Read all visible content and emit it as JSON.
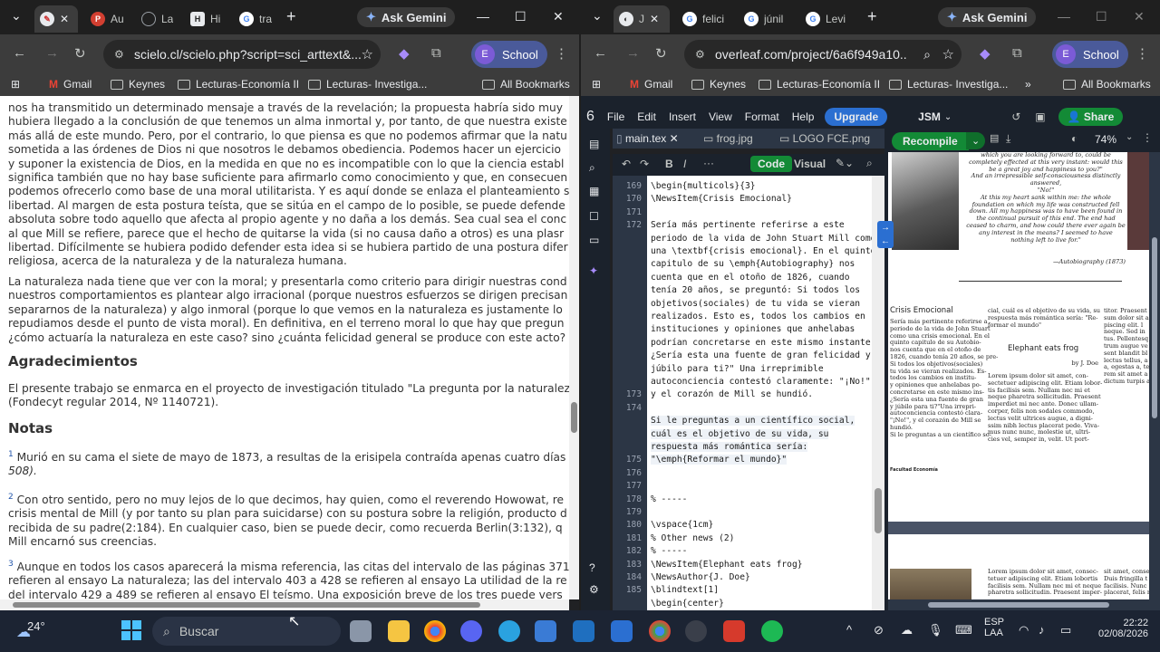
{
  "left": {
    "tabs": [
      {
        "title": "",
        "color": "#e8eaed"
      },
      {
        "title": "Au",
        "color": "#d23f31"
      },
      {
        "title": "La",
        "color": "#9aa0a6"
      },
      {
        "title": "Hi",
        "color": "#e8eaed"
      },
      {
        "title": "tra",
        "color": "#4285f4"
      }
    ],
    "gemini": "Ask Gemini",
    "url": "scielo.cl/scielo.php?script=sci_arttext&...",
    "profile": "School",
    "profile_initial": "E",
    "bookmarks": [
      "Gmail",
      "Keynes",
      "Lecturas-Economía II",
      "Lecturas- Investiga...",
      "All Bookmarks"
    ],
    "paragraphs": [
      [
        "nos ha transmitido un determinado mensaje a través de la revelación; la propuesta habría sido muy",
        "hubiera llegado a la conclusión de que tenemos un alma inmortal y, por tanto, de que nuestra existe",
        "más allá de este mundo. Pero, por el contrario, lo que piensa es que no podemos afirmar que la natu",
        "sometida a las órdenes de Dios ni que nosotros le debamos obediencia. Podemos hacer un ejercicio",
        "y suponer la existencia de Dios, en la medida en que no es incompatible con lo que la ciencia establ",
        "significa también que no hay base suficiente para afirmarlo como conocimiento y que, en consecuen",
        "podemos ofrecerlo como base de una moral utilitarista. Y es aquí donde se enlaza el planteamiento s",
        "libertad. Al margen de esta postura teísta, que se sitúa en el campo de lo posible, se puede defende",
        "absoluta sobre todo aquello que afecta al propio agente y no daña a los demás. Sea cual sea el conc",
        "al que Mill se refiere, parece que el hecho de quitarse la vida (si no causa daño a otros) es una plasr",
        "libertad. Difícilmente se hubiera podido defender esta idea si se hubiera partido de una postura difer",
        "religiosa, acerca de la naturaleza y de la naturaleza humana."
      ],
      [
        "La naturaleza nada tiene que ver con la moral; y presentarla como criterio para dirigir nuestras cond",
        "nuestros comportamientos es plantear algo irracional (porque nuestros esfuerzos se dirigen precisan",
        "separarnos de la naturaleza) y algo inmoral (porque lo que vemos en la naturaleza es justamente lo",
        "repudiamos desde el punto de vista moral). En definitiva, en el terreno moral lo que hay que pregun",
        "¿cómo actuaría la naturaleza en este caso? sino ¿cuánta felicidad general se produce con este acto?"
      ]
    ],
    "ack_heading": "Agradecimientos",
    "ack": [
      "El presente trabajo se enmarca en el proyecto de investigación titulado \"La pregunta por la naturalez",
      "(Fondecyt regular 2014, Nº 1140721)."
    ],
    "notes_heading": "Notas",
    "notes": [
      {
        "n": "1",
        "lines": [
          "Murió en su cama el siete de mayo de 1873, a resultas de la erisipela contraída apenas cuatro días",
          "508)."
        ]
      },
      {
        "n": "2",
        "lines": [
          "Con otro sentido, pero no muy lejos de lo que decimos, hay quien, como el reverendo Howowat, re",
          "crisis mental de Mill (y por tanto su plan para suicidarse) con su postura sobre la religión, producto d",
          "recibida de su padre(2:184). En cualquier caso, bien se puede decir, como recuerda Berlin(3:132), q",
          "Mill encarnó sus creencias."
        ]
      },
      {
        "n": "3",
        "lines": [
          "Aunque en todos los casos aparecerá la misma referencia, las citas del intervalo de las páginas 371",
          "refieren al ensayo La naturaleza; las del intervalo 403 a 428 se refieren al ensayo La utilidad de la re",
          "del intervalo 429 a 489 se refieren al ensayo El teísmo. Una exposición breve de los tres puede vers"
        ]
      }
    ]
  },
  "right": {
    "tabs": [
      {
        "title": "J",
        "color": "#e8eaed"
      },
      {
        "title": "felici",
        "color": "#4285f4"
      },
      {
        "title": "júnil",
        "color": "#4285f4"
      },
      {
        "title": "Levi",
        "color": "#4285f4"
      }
    ],
    "gemini": "Ask Gemini",
    "url": "overleaf.com/project/6a6f949a10...",
    "profile": "School",
    "profile_initial": "E",
    "bookmarks": [
      "Gmail",
      "Keynes",
      "Lecturas-Economía II",
      "Lecturas- Investiga...",
      "All Bookmarks"
    ],
    "menu": [
      "File",
      "Edit",
      "Insert",
      "View",
      "Format",
      "Help"
    ],
    "upgrade": "Upgrade",
    "project": "JSM",
    "share": "Share",
    "files": [
      "main.tex",
      "frog.jpg",
      "LOGO FCE.png"
    ],
    "mode_code": "Code",
    "mode_visual": "Visual",
    "recompile": "Recompile",
    "zoom": "74%",
    "line_numbers": [
      "169",
      "170",
      "171",
      "172",
      "",
      "",
      "",
      "",
      "",
      "",
      "",
      "",
      "",
      "",
      "",
      "",
      "173",
      "174",
      "",
      "",
      "",
      "175",
      "176",
      "177",
      "178",
      "179",
      "180",
      "181",
      "182",
      "183",
      "184",
      "185"
    ],
    "code_lines": [
      "  \\begin{multicols}{3}",
      "    \\NewsItem{Crisis Emocional}",
      "",
      "Sería más pertinente referirse a este",
      "periodo de la vida de John Stuart Mill como",
      "una \\textbf{crisis emocional}. En el quinto",
      "capitulo de su \\emph{Autobiography} nos",
      "cuenta que en el otoño de 1826, cuando",
      "tenía 20 años, se preguntó: Si todos los",
      "objetivos(sociales) de tu vida se vieran",
      "realizados. Esto es, todos los cambios en",
      "instituciones y opiniones que anhelabas",
      "podrían concretarse en este mismo instante.",
      "¿Sería esta una fuente de gran felicidad y",
      "júbilo para ti?\" Una irreprimible",
      "autoconciencia contestó claramente: \"¡No!\",",
      "y el corazón de Mill se hundió.",
      "",
      "Si le preguntas a un científico social,",
      "cuál es el objetivo de su vida, su",
      "respuesta más romántica sería:",
      "\"\\emph{Reformar el mundo}\"",
      "",
      "",
      "% -----",
      "",
      "\\vspace{1cm}",
      "% Other news (2)",
      "% -----",
      "\\NewsItem{Elephant eats frog}",
      "\\NewsAuthor{J. Doe}",
      "    \\blindtext[1]",
      "        \\begin{center}"
    ],
    "pdf": {
      "quote": [
        "which you are looking forward to, could be",
        "completely effected at this very instant: would this",
        "be a great joy and happiness to you?\"",
        "And an irrepressible self-consciousness distinctly",
        "answered,",
        "\"No!\"",
        "At this my heart sank within me: the whole",
        "foundation on which my life was constructed fell",
        "down. All my happiness was to have been found in",
        "the continual pursuit of this end. The end had",
        "ceased to charm, and how could there ever again be",
        "any interest in the means? I seemed to have",
        "nothing left to live for.\""
      ],
      "quote_src": "—Autobiography (1873)",
      "col1_title": "Crisis Emocional",
      "col1": [
        "Sería más pertinente referirse a",
        "periodo de la vida de John Stuart",
        "como una crisis emocional. En el",
        "quinto capitulo de su Autobio-",
        "nos cuenta que en el otoño de",
        "1826, cuando tenía 20 años, se pre-",
        "Si todos los objetivos(sociales)",
        "tu vida se vieran realizados. Es-",
        "todos los cambios en institu-",
        "y opiniones que anhelabas po-",
        "concretarse en este mismo ins-",
        "¿Sería esta una fuente de gran",
        "y júbilo para ti?\"Una irrepri-",
        "autoconciencia contestó clara-",
        "\"¡No!\", y el corazón de Mill se",
        "hundió.",
        "Si le preguntas a un científico so-"
      ],
      "col2_top": [
        "cial, cuál es el objetivo de su vida, su",
        "respuesta más romántica sería: \"Re-",
        "formar el mundo\""
      ],
      "col2_title": "Elephant eats frog",
      "col2_author": "by J. Doe",
      "col2": [
        "Lorem ipsum dolor sit amet, con-",
        "sectetuer adipiscing elit. Etiam lobor-",
        "tis facilisis sem. Nullam nec mi et",
        "neque pharetra sollicitudin. Praesent",
        "imperdiet mi nec ante. Donec ullam-",
        "corper, felis non sodales commodo,",
        "lectus velit ultrices augue, a digni-",
        "ssim nibh lectus placerat pede. Vivа-",
        "mus nunc nunc, molestie ut, ultri-",
        "cies vel, semper in, velit. Ut port-"
      ],
      "col3": [
        "titor. Praesent",
        "sum dolor sit a",
        "piscing elit. l",
        "neque. Sed in",
        "tus. Pellentesq",
        "trum augue ve",
        "sent blandit bl",
        "lectus tellus, a",
        "a, egestas a, te",
        "rem sit amet a",
        "dictum turpis a"
      ],
      "footer": "Facultad Economía",
      "page2_left": [],
      "page2_col2": [
        "Lorem ipsum dolor sit amet, consec-",
        "tetuer adipiscing elit. Etiam lobortis",
        "facilisis sem. Nullam nec mi et neque",
        "pharetra sollicitudin. Praesent imper-"
      ],
      "page2_col3": [
        "sit amet, conse",
        "Duis fringilla t",
        "facilisis. Nunc",
        "placerat, felis n"
      ]
    }
  },
  "taskbar": {
    "temp": "24°",
    "search": "Buscar",
    "lang1": "ESP",
    "lang2": "LAA",
    "time": "22:22",
    "date": "02/08/2026"
  }
}
